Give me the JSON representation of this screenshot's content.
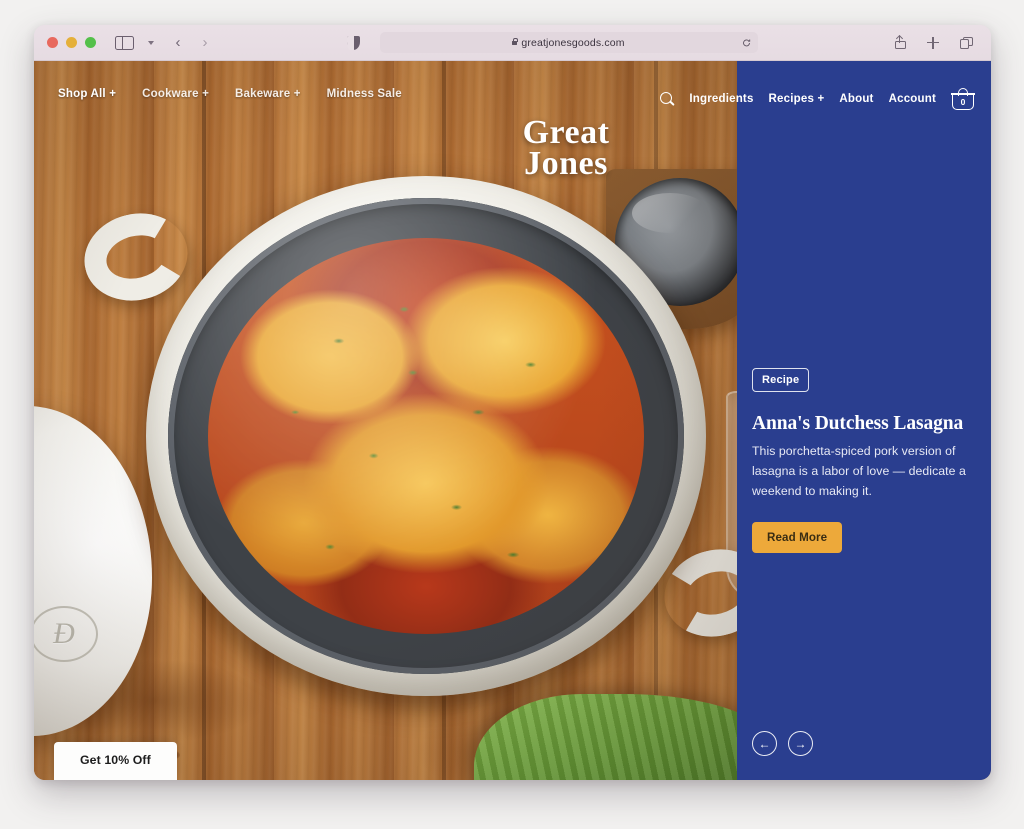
{
  "browser": {
    "traffic_lights": [
      "close",
      "minimize",
      "zoom"
    ],
    "sidebar_toggle": "sidebar-toggle",
    "tab_overview_chevron": "chevron-down",
    "back_label": "‹",
    "forward_label": "›",
    "shield_label": "privacy-shield",
    "url": "greatjonesgoods.com",
    "reload_label": "⟳",
    "share_label": "share",
    "new_tab_label": "+",
    "tabs_label": "tab-overview"
  },
  "site": {
    "brand": {
      "line1": "Great",
      "line2": "Jones"
    },
    "nav_left": [
      {
        "label": "Shop All +"
      },
      {
        "label": "Cookware +"
      },
      {
        "label": "Bakeware +"
      },
      {
        "label": "Midness Sale"
      }
    ],
    "nav_right": [
      {
        "label": "Ingredients"
      },
      {
        "label": "Recipes +"
      },
      {
        "label": "About"
      },
      {
        "label": "Account"
      }
    ],
    "search_icon": "search-icon",
    "cart": {
      "count": "0"
    },
    "promo_tab": "Get 10% Off"
  },
  "panel": {
    "badge": "Recipe",
    "title": "Anna's Dutchess Lasagna",
    "description": "This porchetta-spiced pork version of lasagna is a labor of love — dedicate a weekend to making it.",
    "cta": "Read More",
    "prev_arrow": "←",
    "next_arrow": "→",
    "accent_color": "#eda93a",
    "background_color": "#2a3e8f"
  },
  "photo": {
    "alt": "Dutch oven of baked lasagna on a wooden board",
    "lid_monogram": "Đ"
  }
}
